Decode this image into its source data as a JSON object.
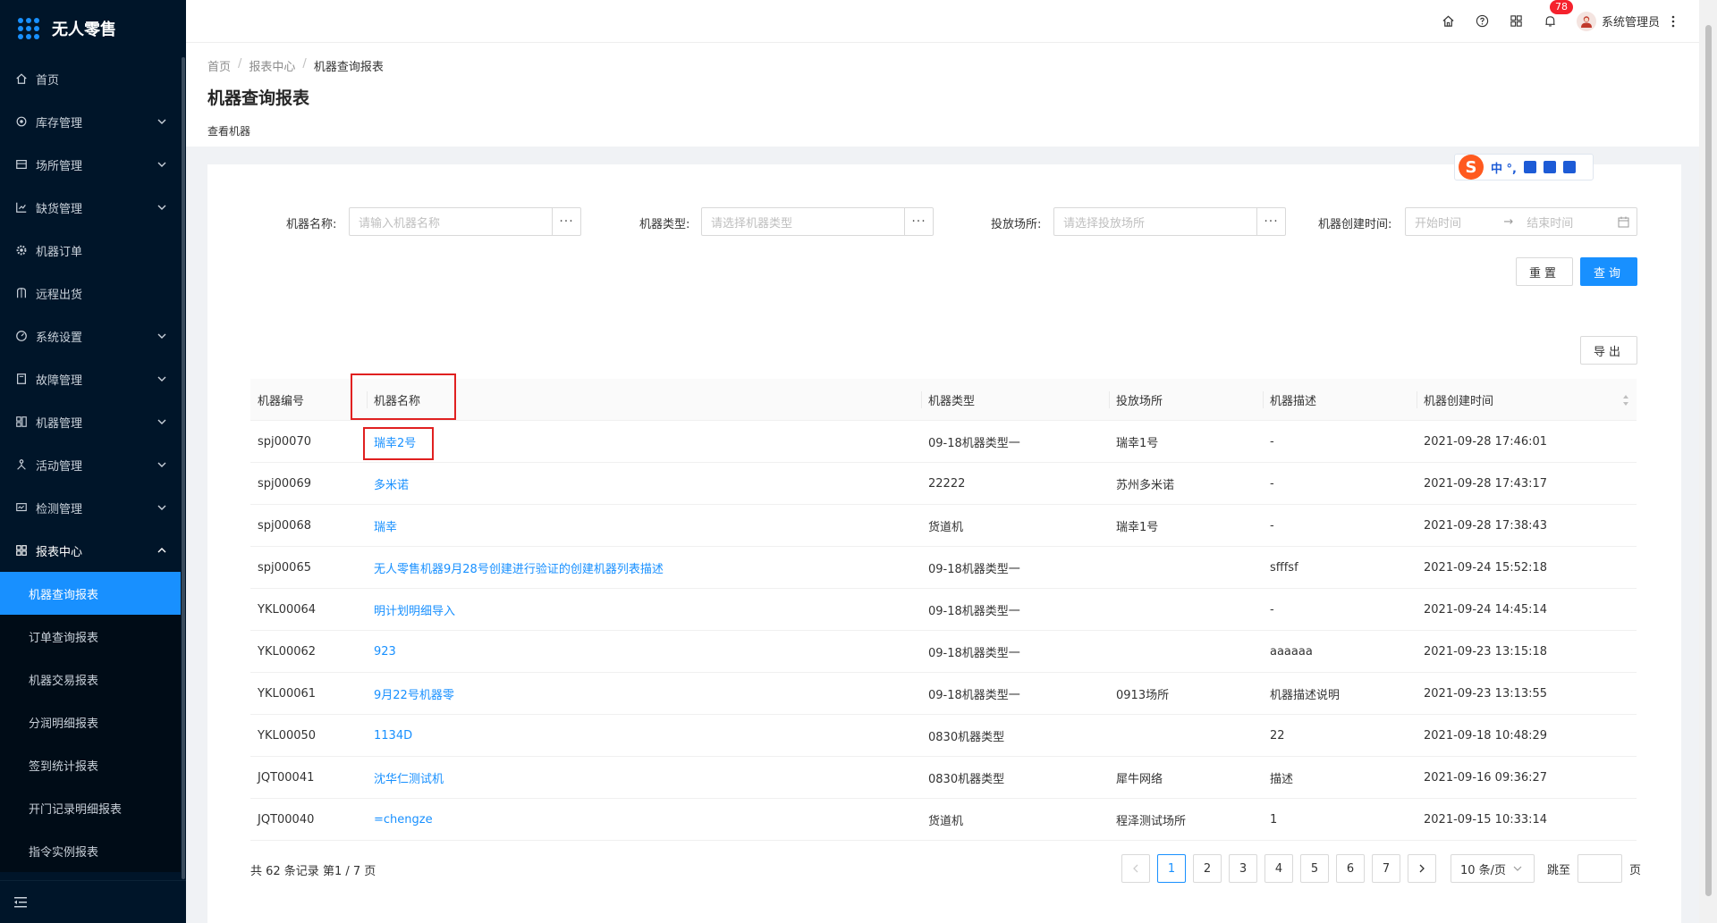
{
  "app": {
    "title": "无人零售"
  },
  "sidebar": {
    "items": [
      {
        "label": "首页",
        "icon": "home-icon",
        "has_arrow": false
      },
      {
        "label": "库存管理",
        "icon": "settings-icon",
        "has_arrow": true
      },
      {
        "label": "场所管理",
        "icon": "building-icon",
        "has_arrow": true
      },
      {
        "label": "缺货管理",
        "icon": "chart-icon",
        "has_arrow": true
      },
      {
        "label": "机器订单",
        "icon": "gear-icon",
        "has_arrow": false
      },
      {
        "label": "远程出货",
        "icon": "user-icon",
        "has_arrow": false
      },
      {
        "label": "系统设置",
        "icon": "dashboard-icon",
        "has_arrow": true
      },
      {
        "label": "故障管理",
        "icon": "doc-icon",
        "has_arrow": true
      },
      {
        "label": "机器管理",
        "icon": "machine-icon",
        "has_arrow": true
      },
      {
        "label": "活动管理",
        "icon": "activity-icon",
        "has_arrow": true
      },
      {
        "label": "检测管理",
        "icon": "monitor-icon",
        "has_arrow": true
      },
      {
        "label": "报表中心",
        "icon": "grid-icon",
        "has_arrow": true,
        "open": true
      }
    ],
    "report_sub": [
      {
        "label": "机器查询报表",
        "active": true
      },
      {
        "label": "订单查询报表"
      },
      {
        "label": "机器交易报表"
      },
      {
        "label": "分润明细报表"
      },
      {
        "label": "签到统计报表"
      },
      {
        "label": "开门记录明细报表"
      },
      {
        "label": "指令实例报表"
      }
    ]
  },
  "header": {
    "notification_count": "78",
    "user_name": "系统管理员"
  },
  "page": {
    "breadcrumb": [
      "首页",
      "报表中心",
      "机器查询报表"
    ],
    "title": "机器查询报表",
    "subtitle": "查看机器"
  },
  "ime": {
    "text": "中 °,"
  },
  "filters": {
    "name_label": "机器名称:",
    "name_placeholder": "请输入机器名称",
    "type_label": "机器类型:",
    "type_placeholder": "请选择机器类型",
    "place_label": "投放场所:",
    "place_placeholder": "请选择投放场所",
    "time_label": "机器创建时间:",
    "start_placeholder": "开始时间",
    "end_placeholder": "结束时间",
    "dots": "···",
    "arrow": "→"
  },
  "buttons": {
    "reset": "重置",
    "query": "查询",
    "export": "导出"
  },
  "table": {
    "columns": [
      "机器编号",
      "机器名称",
      "机器类型",
      "投放场所",
      "机器描述",
      "机器创建时间"
    ],
    "rows": [
      [
        "spj00070",
        "瑞幸2号",
        "09-18机器类型一",
        "瑞幸1号",
        "-",
        "2021-09-28 17:46:01"
      ],
      [
        "spj00069",
        "多米诺",
        "22222",
        "苏州多米诺",
        "-",
        "2021-09-28 17:43:17"
      ],
      [
        "spj00068",
        "瑞幸",
        "货道机",
        "瑞幸1号",
        "-",
        "2021-09-28 17:38:43"
      ],
      [
        "spj00065",
        "无人零售机器9月28号创建进行验证的创建机器列表描述",
        "09-18机器类型一",
        "",
        "sfffsf",
        "2021-09-24 15:52:18"
      ],
      [
        "YKL00064",
        "明计划明细导入",
        "09-18机器类型一",
        "",
        "-",
        "2021-09-24 14:45:14"
      ],
      [
        "YKL00062",
        "923",
        "09-18机器类型一",
        "",
        "aaaaaa",
        "2021-09-23 13:15:18"
      ],
      [
        "YKL00061",
        "9月22号机器零",
        "09-18机器类型一",
        "0913场所",
        "机器描述说明",
        "2021-09-23 13:13:55"
      ],
      [
        "YKL00050",
        "1134D",
        "0830机器类型",
        "",
        "22",
        "2021-09-18 10:48:29"
      ],
      [
        "JQT00041",
        "沈华仁测试机",
        "0830机器类型",
        "犀牛网络",
        "描述",
        "2021-09-16 09:36:27"
      ],
      [
        "JQT00040",
        "=chengze",
        "货道机",
        "程泽测试场所",
        "1",
        "2021-09-15 10:33:14"
      ]
    ]
  },
  "pagination": {
    "total_text": "共 62 条记录 第1 / 7 页",
    "pages": [
      "1",
      "2",
      "3",
      "4",
      "5",
      "6",
      "7"
    ],
    "current": "1",
    "page_size": "10 条/页",
    "jump_label": "跳至",
    "page_unit": "页"
  }
}
